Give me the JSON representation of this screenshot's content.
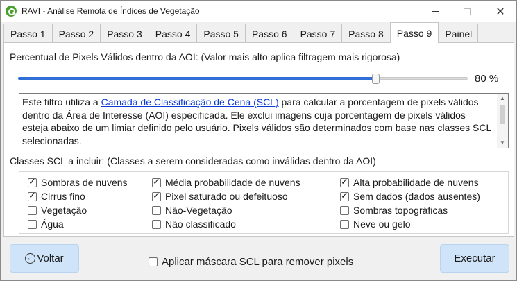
{
  "window": {
    "title": "RAVI - Análise Remota de Índices de Vegetação",
    "controls": {
      "minimize": "minimize",
      "maximize": "maximize",
      "close": "✕"
    }
  },
  "tabs": [
    {
      "label": "Passo 1",
      "active": false
    },
    {
      "label": "Passo 2",
      "active": false
    },
    {
      "label": "Passo 3",
      "active": false
    },
    {
      "label": "Passo 4",
      "active": false
    },
    {
      "label": "Passo 5",
      "active": false
    },
    {
      "label": "Passo 6",
      "active": false
    },
    {
      "label": "Passo 7",
      "active": false
    },
    {
      "label": "Passo 8",
      "active": false
    },
    {
      "label": "Passo 9",
      "active": true
    },
    {
      "label": "Painel",
      "active": false
    }
  ],
  "filter": {
    "label": "Percentual de Pixels Válidos dentro da AOI: (Valor mais alto aplica filtragem mais rigorosa)",
    "slider_value": 80,
    "slider_value_text": "80 %",
    "accent_color": "#2f6fd6"
  },
  "description": {
    "prefix": "Este filtro utiliza a ",
    "link": "Camada de Classificação de Cena (SCL)",
    "suffix": " para calcular a porcentagem de pixels válidos dentro da Área de Interesse (AOI) especificada. Ele exclui imagens cuja porcentagem de pixels válidos esteja abaixo de um limiar definido pelo usuário. Pixels válidos são determinados com base nas classes SCL selecionadas."
  },
  "classes": {
    "label": "Classes SCL a incluir: (Classes a serem consideradas como inválidas dentro da AOI)",
    "items": [
      {
        "label": "Sombras de nuvens",
        "checked": true
      },
      {
        "label": "Média probabilidade de nuvens",
        "checked": true
      },
      {
        "label": "Alta probabilidade de nuvens",
        "checked": true
      },
      {
        "label": "Cirrus fino",
        "checked": true
      },
      {
        "label": "Pixel saturado ou defeituoso",
        "checked": true
      },
      {
        "label": "Sem dados (dados ausentes)",
        "checked": true
      },
      {
        "label": "Vegetação",
        "checked": false
      },
      {
        "label": "Não-Vegetação",
        "checked": false
      },
      {
        "label": "Sombras topográficas",
        "checked": false
      },
      {
        "label": "Água",
        "checked": false
      },
      {
        "label": "Não classificado",
        "checked": false
      },
      {
        "label": "Neve ou gelo",
        "checked": false
      }
    ]
  },
  "footer": {
    "back_label": "Voltar",
    "mask_label": "Aplicar máscara SCL para remover pixels",
    "mask_checked": false,
    "run_label": "Executar"
  }
}
